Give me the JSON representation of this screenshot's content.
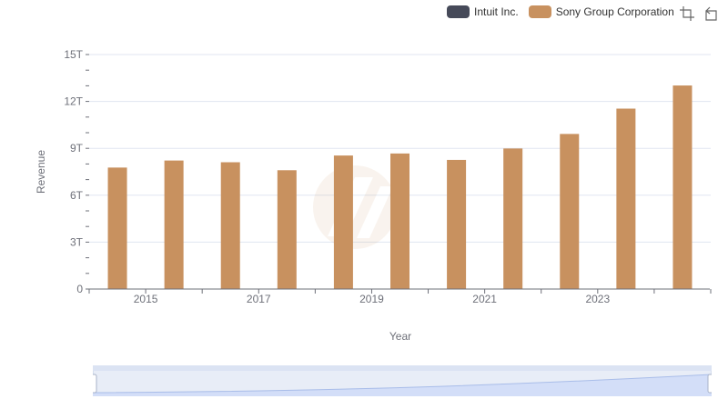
{
  "legend": {
    "items": [
      {
        "label": "Intuit Inc.",
        "color": "#464a59"
      },
      {
        "label": "Sony Group Corporation",
        "color": "#c8915f"
      }
    ]
  },
  "toolbox": {
    "icons": [
      "zoom-icon",
      "zoom-reset-icon"
    ]
  },
  "chart_data": {
    "type": "bar",
    "xlabel": "Year",
    "ylabel": "Revenue",
    "ylim": [
      0,
      15000000000000
    ],
    "y_ticks": [
      "0",
      "3T",
      "6T",
      "9T",
      "12T",
      "15T"
    ],
    "x_ticks": [
      "2015",
      "2017",
      "2019",
      "2021",
      "2023"
    ],
    "categories": [
      "2014",
      "2015",
      "2016",
      "2017",
      "2018",
      "2019",
      "2020",
      "2021",
      "2022",
      "2023",
      "2024"
    ],
    "series": [
      {
        "name": "Intuit Inc.",
        "color": "#464a59",
        "values": [
          4500000000,
          4190000000,
          4690000000,
          5180000000,
          5960000000,
          6780000000,
          7680000000,
          9630000000,
          12730000000,
          14370000000,
          16290000000
        ]
      },
      {
        "name": "Sony Group Corporation",
        "color": "#c8915f",
        "values": [
          7770000000000,
          8220000000000,
          8110000000000,
          7600000000000,
          8540000000000,
          8670000000000,
          8260000000000,
          8990000000000,
          9920000000000,
          11540000000000,
          13020000000000
        ]
      }
    ],
    "grid": true,
    "legend_position": "top-right"
  }
}
